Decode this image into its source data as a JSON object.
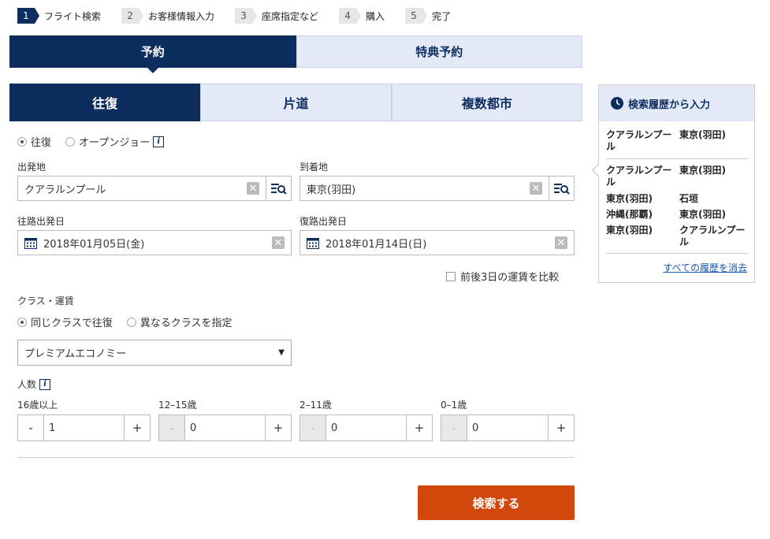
{
  "steps": [
    {
      "num": "1",
      "label": "フライト検索"
    },
    {
      "num": "2",
      "label": "お客様情報入力"
    },
    {
      "num": "3",
      "label": "座席指定など"
    },
    {
      "num": "4",
      "label": "購入"
    },
    {
      "num": "5",
      "label": "完了"
    }
  ],
  "booking_tabs": {
    "reservation": "予約",
    "award": "特典予約"
  },
  "trip_tabs": {
    "round": "往復",
    "oneway": "片道",
    "multi": "複数都市"
  },
  "trip_radio": {
    "round": "往復",
    "open_jaw": "オープンジョー"
  },
  "departure": {
    "label": "出発地",
    "value": "クアラルンプール"
  },
  "arrival": {
    "label": "到着地",
    "value": "東京(羽田)"
  },
  "outbound_date": {
    "label": "往路出発日",
    "value": "2018年01月05日(金)"
  },
  "return_date": {
    "label": "復路出発日",
    "value": "2018年01月14日(日)"
  },
  "compare_fares": "前後3日の運賃を比較",
  "class_section": {
    "label": "クラス・運賃",
    "same": "同じクラスで往復",
    "different": "異なるクラスを指定",
    "selected": "プレミアムエコノミー"
  },
  "passengers": {
    "label": "人数",
    "groups": [
      {
        "label": "16歳以上",
        "value": "1"
      },
      {
        "label": "12–15歳",
        "value": "0"
      },
      {
        "label": "2–11歳",
        "value": "0"
      },
      {
        "label": "0–1歳",
        "value": "0"
      }
    ],
    "minus": "-",
    "plus": "+"
  },
  "search_button": "検索する",
  "history": {
    "title": "検索履歴から入力",
    "entries": [
      {
        "from": "クアラルンプール",
        "to": "東京(羽田)"
      },
      {
        "from": "クアラルンプール",
        "to": "東京(羽田)"
      },
      {
        "from": "東京(羽田)",
        "to": "石垣"
      },
      {
        "from": "沖縄(那覇)",
        "to": "東京(羽田)"
      },
      {
        "from": "東京(羽田)",
        "to": "クアラルンプール"
      }
    ],
    "clear_all": "すべての履歴を消去"
  },
  "colors": {
    "navy": "#0d2d5e",
    "tab_light": "#e3e9f7",
    "search_orange": "#d2480c",
    "link_blue": "#1a56b0"
  }
}
